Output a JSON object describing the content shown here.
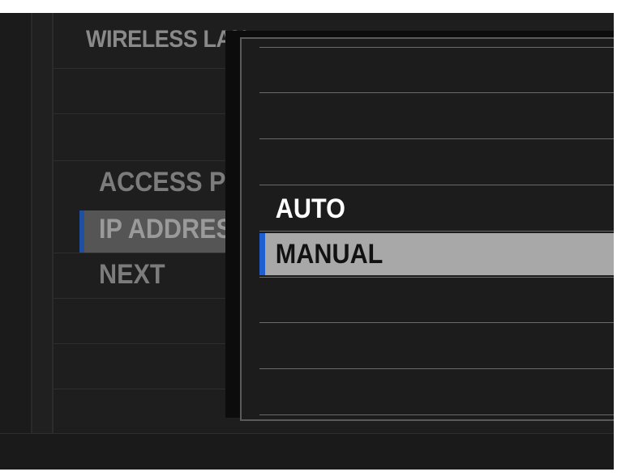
{
  "screen": {
    "title": "WIRELESS LAN"
  },
  "menu": {
    "items": [
      {
        "label": "ACCESS POINT SETTINGS"
      },
      {
        "label": "IP ADDRESS SETTING",
        "selected": true
      },
      {
        "label": "NEXT"
      }
    ]
  },
  "popup": {
    "options": [
      {
        "label": "AUTO",
        "selected": false
      },
      {
        "label": "MANUAL",
        "selected": true
      }
    ]
  },
  "colors": {
    "accent": "#1f5fd0",
    "selected_bg": "#a8a8a8",
    "background": "#1c1c1c"
  }
}
